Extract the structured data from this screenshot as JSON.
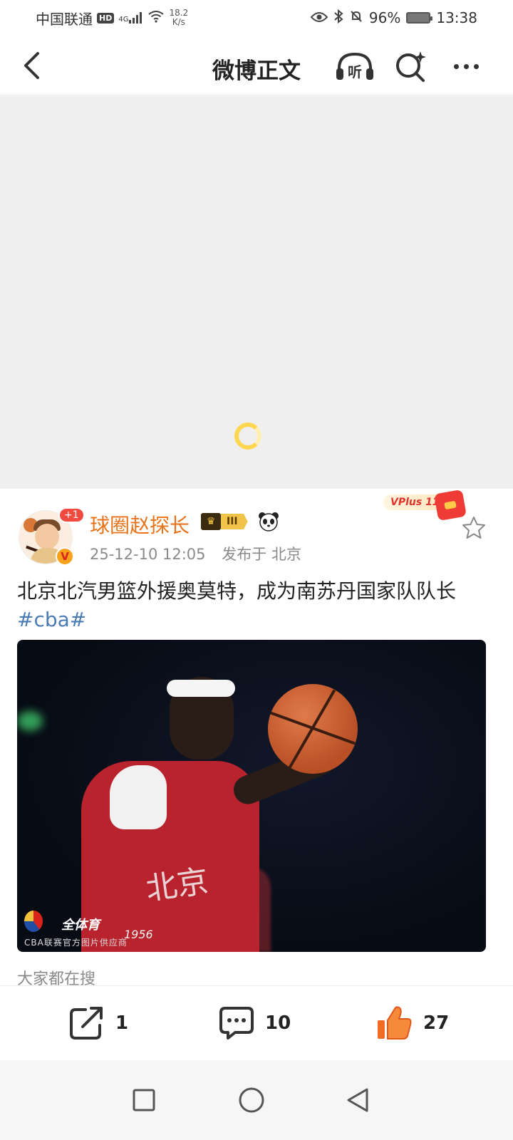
{
  "status_bar": {
    "carrier": "中国联通",
    "hd": "HD",
    "network": "4G",
    "speed_value": "18.2",
    "speed_unit": "K/s",
    "battery": "96%",
    "time": "13:38"
  },
  "nav": {
    "title": "微博正文",
    "listen_label": "听"
  },
  "post": {
    "avatar_badge": "+1",
    "verified_badge": "V",
    "username": "球圈赵探长",
    "member_level": "III",
    "timestamp": "25-12-10 12:05",
    "location": "发布于 北京",
    "promo_label": "VPlus 11·11",
    "text": "北京北汽男篮外援奥莫特，成为南苏丹国家队队长 ",
    "topic": "#cba#",
    "photo": {
      "jersey_text": "北京",
      "jersey_year": "1956",
      "watermark_brand": "全体育",
      "watermark_caption": "CBA联赛官方图片供应商"
    },
    "everyone_searching": "大家都在搜"
  },
  "actions": {
    "share_count": "1",
    "comment_count": "10",
    "like_count": "27"
  },
  "colors": {
    "username": "#e8731a",
    "topic": "#4a7bb5",
    "like_orange": "#f26b23"
  }
}
